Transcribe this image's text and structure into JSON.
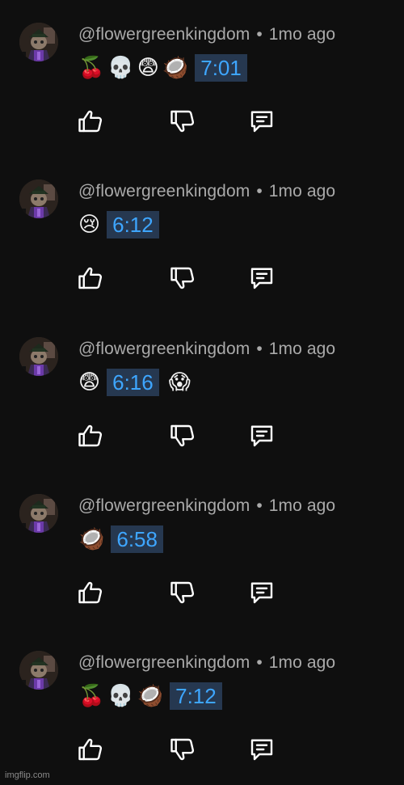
{
  "comments": [
    {
      "handle": "@flowergreenkingdom",
      "age": "1mo ago",
      "emojis_before": [
        "🍒",
        "💀",
        "😨",
        "🥥"
      ],
      "timestamp": "7:01",
      "emojis_after": []
    },
    {
      "handle": "@flowergreenkingdom",
      "age": "1mo ago",
      "emojis_before": [
        "😢"
      ],
      "timestamp": "6:12",
      "emojis_after": []
    },
    {
      "handle": "@flowergreenkingdom",
      "age": "1mo ago",
      "emojis_before": [
        "😨"
      ],
      "timestamp": "6:16",
      "emojis_after": [
        "😱"
      ]
    },
    {
      "handle": "@flowergreenkingdom",
      "age": "1mo ago",
      "emojis_before": [
        "🥥"
      ],
      "timestamp": "6:58",
      "emojis_after": []
    },
    {
      "handle": "@flowergreenkingdom",
      "age": "1mo ago",
      "emojis_before": [
        "🍒",
        "💀",
        "🥥"
      ],
      "timestamp": "7:12",
      "emojis_after": []
    }
  ],
  "separator": "•",
  "icons": {
    "like": "thumbs-up-icon",
    "dislike": "thumbs-down-icon",
    "reply": "reply-comment-icon"
  },
  "colors": {
    "background": "#0f0f0f",
    "meta_text": "#aaaaaa",
    "timestamp_text": "#3ea6ff",
    "timestamp_bg": "#263850",
    "icon": "#ffffff"
  },
  "watermark": "imgflip.com"
}
